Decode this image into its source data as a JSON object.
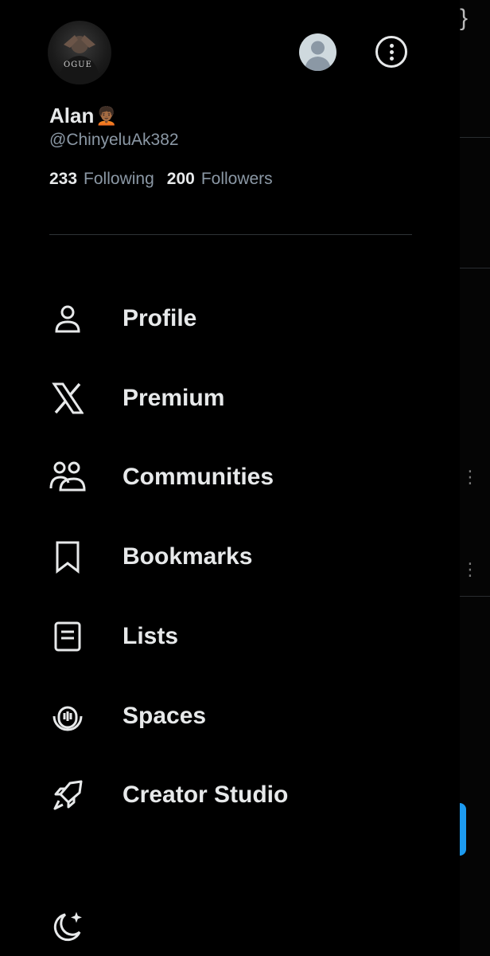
{
  "profile": {
    "name": "Alan",
    "name_emoji": "🧑🏾‍🦱",
    "handle": "@ChinyeluAk382",
    "following_count": "233",
    "following_label": "Following",
    "followers_count": "200",
    "followers_label": "Followers",
    "avatar_text": "OGUE"
  },
  "menu": {
    "items": [
      {
        "label": "Profile",
        "icon": "person-icon"
      },
      {
        "label": "Premium",
        "icon": "x-logo-icon"
      },
      {
        "label": "Communities",
        "icon": "communities-icon"
      },
      {
        "label": "Bookmarks",
        "icon": "bookmark-icon"
      },
      {
        "label": "Lists",
        "icon": "list-icon"
      },
      {
        "label": "Spaces",
        "icon": "spaces-icon"
      },
      {
        "label": "Creator Studio",
        "icon": "rocket-icon"
      }
    ]
  },
  "colors": {
    "background": "#000000",
    "text_primary": "#e7e9ea",
    "text_secondary": "#8b98a5",
    "accent": "#1d9bf0"
  }
}
